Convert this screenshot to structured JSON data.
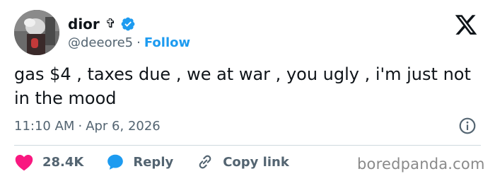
{
  "author": {
    "display_name": "dior",
    "name_symbol": "✞",
    "handle": "@deeore5",
    "separator": "·",
    "follow_label": "Follow",
    "verified": true
  },
  "tweet": {
    "text": "gas $4 , taxes due , we at war , you ugly , i'm just not in the mood",
    "time": "11:10 AM",
    "meta_separator": "·",
    "date": "Apr 6, 2026"
  },
  "actions": {
    "like_count": "28.4K",
    "reply_label": "Reply",
    "copy_label": "Copy link"
  },
  "watermark": "boredpanda.com",
  "colors": {
    "accent": "#1d9bf0",
    "like": "#f91880",
    "text": "#0f1419",
    "muted": "#536471"
  },
  "icons": {
    "logo": "x-logo-icon",
    "verified": "verified-badge-icon",
    "info": "info-icon",
    "like": "heart-icon",
    "reply": "speech-bubble-icon",
    "copy": "link-icon"
  }
}
